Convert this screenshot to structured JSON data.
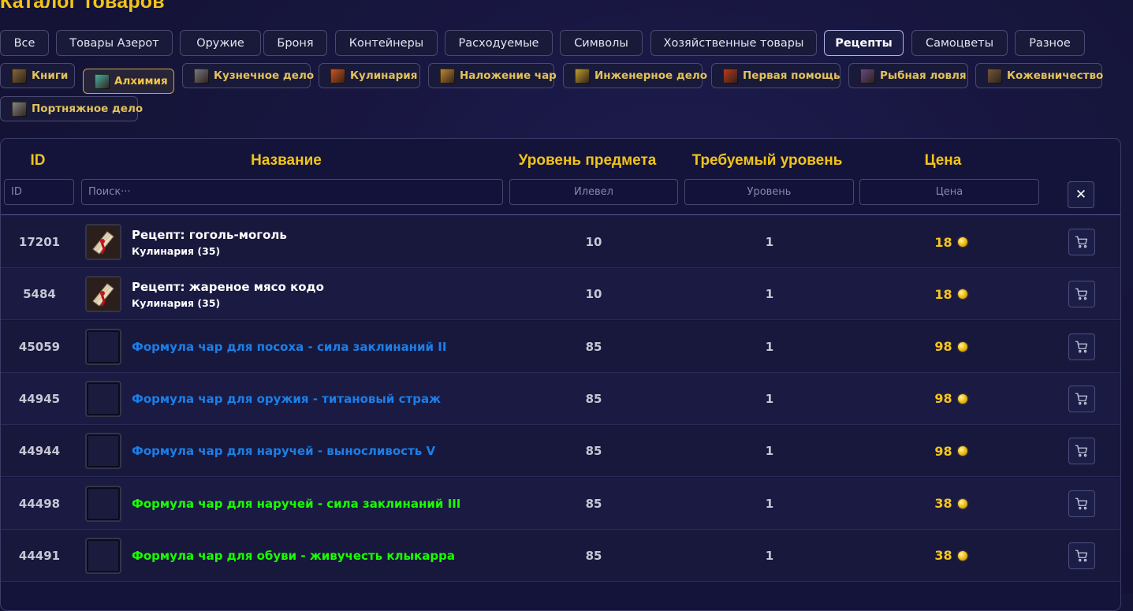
{
  "page_title": "Каталог товаров",
  "categories": [
    {
      "label": "Все",
      "active": false
    },
    {
      "label": "Товары Азерот",
      "active": false
    },
    {
      "label": "Оружие",
      "active": false
    },
    {
      "label": "Броня",
      "active": false
    },
    {
      "label": "Контейнеры",
      "active": false
    },
    {
      "label": "Расходуемые",
      "active": false
    },
    {
      "label": "Символы",
      "active": false
    },
    {
      "label": "Хозяйственные товары",
      "active": false
    },
    {
      "label": "Рецепты",
      "active": true
    },
    {
      "label": "Самоцветы",
      "active": false
    },
    {
      "label": "Разное",
      "active": false
    }
  ],
  "subcategories": [
    {
      "label": "Книги",
      "icon": "book-icon",
      "color": "#8a6a3e",
      "active": false
    },
    {
      "label": "Алхимия",
      "icon": "alchemy-flask-icon",
      "color": "#4fb3a8",
      "active": true
    },
    {
      "label": "Кузнечное дело",
      "icon": "anvil-icon",
      "color": "#7d7d86",
      "active": false
    },
    {
      "label": "Кулинария",
      "icon": "cooking-pot-icon",
      "color": "#d4571e",
      "active": false
    },
    {
      "label": "Наложение чар",
      "icon": "enchanting-scroll-icon",
      "color": "#c58a36",
      "active": false
    },
    {
      "label": "Инженерное дело",
      "icon": "engineering-gear-icon",
      "color": "#c9a02a",
      "active": false
    },
    {
      "label": "Первая помощь",
      "icon": "first-aid-icon",
      "color": "#c23a1c",
      "active": false
    },
    {
      "label": "Рыбная ловля",
      "icon": "fishing-rod-icon",
      "color": "#6b4a8a",
      "active": false
    },
    {
      "label": "Кожевничество",
      "icon": "leather-icon",
      "color": "#7a5a3a",
      "active": false
    },
    {
      "label": "Портняжное дело",
      "icon": "tailoring-icon",
      "color": "#8a8a8e",
      "active": false
    }
  ],
  "table": {
    "headers": {
      "id": "ID",
      "name": "Название",
      "item_level": "Уровень предмета",
      "required_level": "Требуемый уровень",
      "price": "Цена"
    },
    "filters": {
      "id_placeholder": "ID",
      "search_placeholder": "Поиск···",
      "ilevel_placeholder": "Илевел",
      "level_placeholder": "Уровень",
      "price_placeholder": "Цена"
    },
    "clear_label": "✕",
    "rows": [
      {
        "id": "17201",
        "name": "Рецепт: гоголь-моголь",
        "subtitle": "Кулинария (35)",
        "quality": "common",
        "icon": "recipe-scroll-icon",
        "item_level": "10",
        "required_level": "1",
        "price": "18"
      },
      {
        "id": "5484",
        "name": "Рецепт: жареное мясо кодо",
        "subtitle": "Кулинария (35)",
        "quality": "common",
        "icon": "recipe-scroll-icon",
        "item_level": "10",
        "required_level": "1",
        "price": "18"
      },
      {
        "id": "45059",
        "name": "Формула чар для посоха - сила заклинаний II",
        "subtitle": "",
        "quality": "rare",
        "icon": "empty-item-icon",
        "item_level": "85",
        "required_level": "1",
        "price": "98"
      },
      {
        "id": "44945",
        "name": "Формула чар для оружия - титановый страж",
        "subtitle": "",
        "quality": "rare",
        "icon": "empty-item-icon",
        "item_level": "85",
        "required_level": "1",
        "price": "98"
      },
      {
        "id": "44944",
        "name": "Формула чар для наручей - выносливость V",
        "subtitle": "",
        "quality": "rare",
        "icon": "empty-item-icon",
        "item_level": "85",
        "required_level": "1",
        "price": "98"
      },
      {
        "id": "44498",
        "name": "Формула чар для наручей - сила заклинаний III",
        "subtitle": "",
        "quality": "uncommon",
        "icon": "empty-item-icon",
        "item_level": "85",
        "required_level": "1",
        "price": "38"
      },
      {
        "id": "44491",
        "name": "Формула чар для обуви - живучесть клыкарра",
        "subtitle": "",
        "quality": "uncommon",
        "icon": "empty-item-icon",
        "item_level": "85",
        "required_level": "1",
        "price": "38"
      }
    ]
  },
  "colors": {
    "accent_gold": "#f2c418",
    "quality_rare": "#1b7fe8",
    "quality_uncommon": "#1aff00",
    "quality_common": "#ffffff",
    "background": "#151439"
  }
}
